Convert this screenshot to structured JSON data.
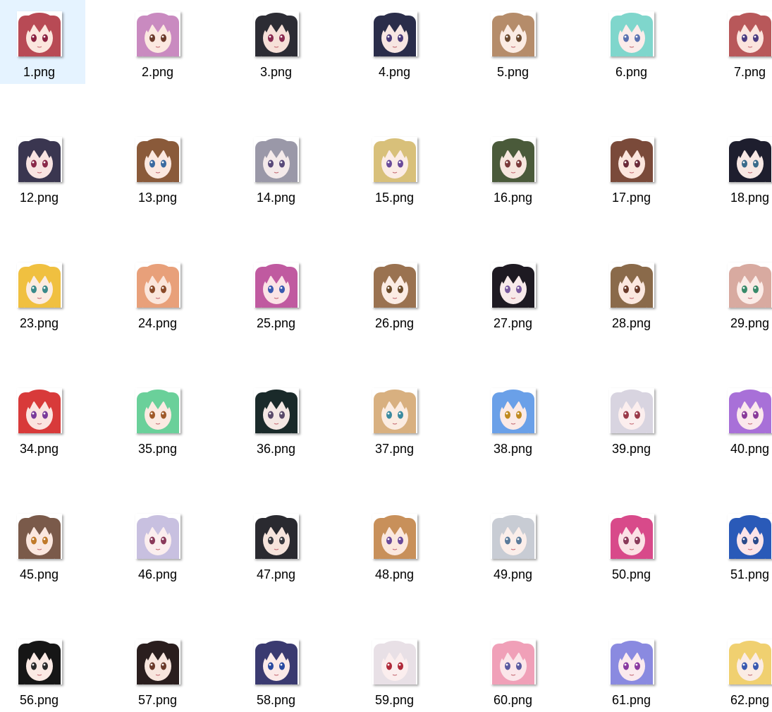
{
  "files": [
    {
      "name": "1.png",
      "hair": "#b84a55",
      "eyes": "#8a2040",
      "skin": "#fbe6de",
      "selected": true
    },
    {
      "name": "2.png",
      "hair": "#c98ac0",
      "eyes": "#6b3a2a",
      "skin": "#fbe8e0"
    },
    {
      "name": "3.png",
      "hair": "#2c2c34",
      "eyes": "#8a2a50",
      "skin": "#f6e0d8"
    },
    {
      "name": "4.png",
      "hair": "#2a2d4a",
      "eyes": "#4a3a7a",
      "skin": "#f7e6e2"
    },
    {
      "name": "5.png",
      "hair": "#b58c6a",
      "eyes": "#6a4a30",
      "skin": "#fbece4"
    },
    {
      "name": "6.png",
      "hair": "#7fd6cc",
      "eyes": "#5a70b0",
      "skin": "#fbecea"
    },
    {
      "name": "7.png",
      "hair": "#b8585a",
      "eyes": "#4a3a80",
      "skin": "#fbe4de"
    },
    {
      "name": "12.png",
      "hair": "#3a3650",
      "eyes": "#8a2a4a",
      "skin": "#f8e4e2"
    },
    {
      "name": "13.png",
      "hair": "#8a5a3a",
      "eyes": "#3a6aa0",
      "skin": "#fbe8e0"
    },
    {
      "name": "14.png",
      "hair": "#9a98a8",
      "eyes": "#5a4a7a",
      "skin": "#f4eaea"
    },
    {
      "name": "15.png",
      "hair": "#d8c07a",
      "eyes": "#6a4a9a",
      "skin": "#fbece6"
    },
    {
      "name": "16.png",
      "hair": "#4a5a3a",
      "eyes": "#7a3a3a",
      "skin": "#f6e6de"
    },
    {
      "name": "17.png",
      "hair": "#7a4a3a",
      "eyes": "#6a2a3a",
      "skin": "#fbe6de"
    },
    {
      "name": "18.png",
      "hair": "#1e1e2e",
      "eyes": "#3a6a8a",
      "skin": "#f8e8e4"
    },
    {
      "name": "23.png",
      "hair": "#f0c040",
      "eyes": "#3a8a8a",
      "skin": "#fbece2"
    },
    {
      "name": "24.png",
      "hair": "#e8a07a",
      "eyes": "#8a4a2a",
      "skin": "#fbe6dc"
    },
    {
      "name": "25.png",
      "hair": "#c05aa0",
      "eyes": "#3a5ab0",
      "skin": "#fbe4e6"
    },
    {
      "name": "26.png",
      "hair": "#9a7250",
      "eyes": "#6a4a2a",
      "skin": "#fbece4"
    },
    {
      "name": "27.png",
      "hair": "#1e1a22",
      "eyes": "#7a5aa0",
      "skin": "#f8eaea"
    },
    {
      "name": "28.png",
      "hair": "#8a6a4a",
      "eyes": "#6a3a2a",
      "skin": "#fbe8e0"
    },
    {
      "name": "29.png",
      "hair": "#d8aaa0",
      "eyes": "#3a8a6a",
      "skin": "#fbece8"
    },
    {
      "name": "34.png",
      "hair": "#d83a3a",
      "eyes": "#7a3a9a",
      "skin": "#fbe4e0"
    },
    {
      "name": "35.png",
      "hair": "#6ad09a",
      "eyes": "#a05a2a",
      "skin": "#fbeae2"
    },
    {
      "name": "36.png",
      "hair": "#1a2a2a",
      "eyes": "#5a4a6a",
      "skin": "#f4e8e4"
    },
    {
      "name": "37.png",
      "hair": "#d8b080",
      "eyes": "#3a8aa0",
      "skin": "#fbece2"
    },
    {
      "name": "38.png",
      "hair": "#6aa0e8",
      "eyes": "#c08a20",
      "skin": "#fbeae6"
    },
    {
      "name": "39.png",
      "hair": "#d8d4e0",
      "eyes": "#9a3a4a",
      "skin": "#fbeeee"
    },
    {
      "name": "40.png",
      "hair": "#a870d8",
      "eyes": "#8a3a9a",
      "skin": "#fbe8ec"
    },
    {
      "name": "45.png",
      "hair": "#7a5a4a",
      "eyes": "#c07a2a",
      "skin": "#fbe8e0"
    },
    {
      "name": "46.png",
      "hair": "#c8c0e0",
      "eyes": "#8a3a5a",
      "skin": "#fbeeee"
    },
    {
      "name": "47.png",
      "hair": "#2a2a30",
      "eyes": "#3a3a40",
      "skin": "#f6e4dc"
    },
    {
      "name": "48.png",
      "hair": "#c8905a",
      "eyes": "#6a4a9a",
      "skin": "#fbe8de"
    },
    {
      "name": "49.png",
      "hair": "#c8ccd4",
      "eyes": "#5a7a9a",
      "skin": "#fbeeea"
    },
    {
      "name": "50.png",
      "hair": "#d84a8a",
      "eyes": "#8a3a5a",
      "skin": "#fbe2e6"
    },
    {
      "name": "51.png",
      "hair": "#2a5ab8",
      "eyes": "#2a4a8a",
      "skin": "#fbe4e8"
    },
    {
      "name": "56.png",
      "hair": "#161616",
      "eyes": "#2a2a2a",
      "skin": "#fbeae4"
    },
    {
      "name": "57.png",
      "hair": "#2a1e1e",
      "eyes": "#6a3a2a",
      "skin": "#f8e6de"
    },
    {
      "name": "58.png",
      "hair": "#3a3a70",
      "eyes": "#2a4aa0",
      "skin": "#fbeae8"
    },
    {
      "name": "59.png",
      "hair": "#e8e0e6",
      "eyes": "#b02a3a",
      "skin": "#fbeeee"
    },
    {
      "name": "60.png",
      "hair": "#f0a0b8",
      "eyes": "#5a5aa0",
      "skin": "#fbe6ea"
    },
    {
      "name": "61.png",
      "hair": "#8a8ae0",
      "eyes": "#8a3aa0",
      "skin": "#fbeaee"
    },
    {
      "name": "62.png",
      "hair": "#f0d070",
      "eyes": "#3a5ab0",
      "skin": "#fbece4"
    }
  ]
}
